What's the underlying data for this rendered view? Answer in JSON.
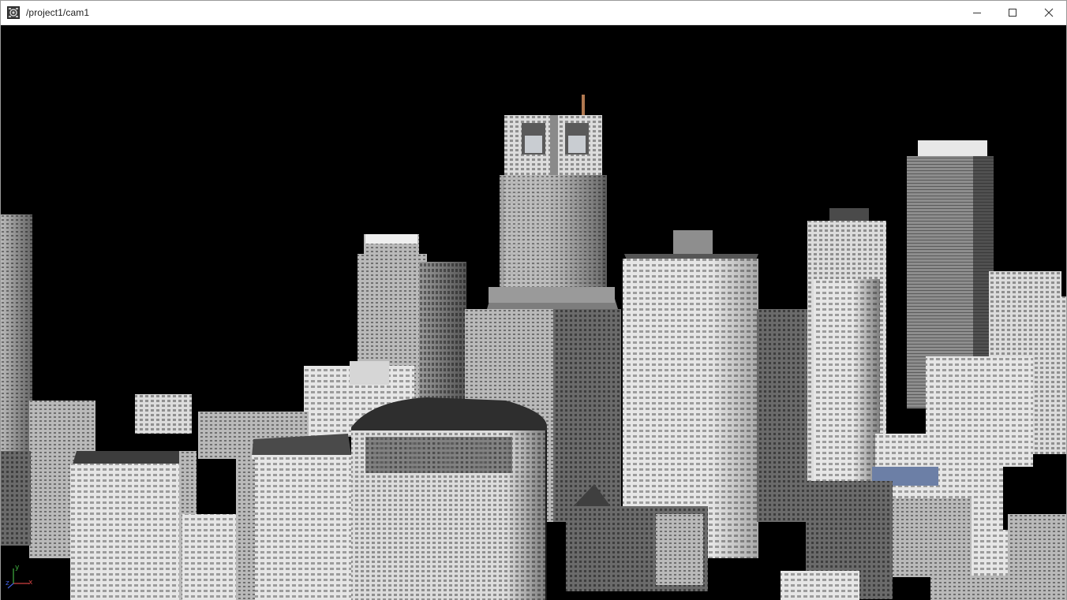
{
  "window": {
    "title": "/project1/cam1",
    "app_icon": "camera-node-icon",
    "controls": {
      "minimize_icon": "minimize-icon",
      "maximize_icon": "maximize-icon",
      "close_icon": "close-icon"
    }
  },
  "viewport": {
    "background": "#000000",
    "axis_gizmo": {
      "x_label": "x",
      "y_label": "y",
      "z_label": "z",
      "x_color": "#d04040",
      "y_color": "#40b040",
      "z_color": "#4060e0"
    }
  }
}
